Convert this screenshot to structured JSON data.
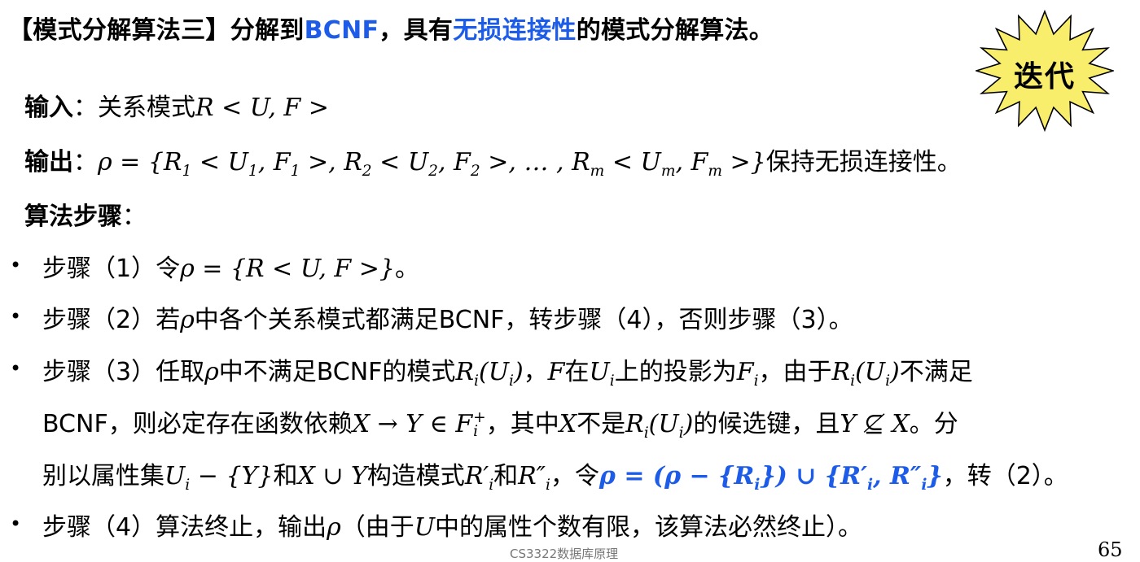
{
  "title": {
    "p1": "【模式分解算法三】分解到",
    "hl1": "BCNF",
    "p2": "，具有",
    "hl2": "无损连接性",
    "p3": "的模式分解算法。"
  },
  "badge": {
    "text": "迭代",
    "color": "#f8ee6c"
  },
  "input": {
    "label": "输入",
    "sep": "：",
    "text": "关系模式",
    "math": "R < U, F >"
  },
  "output": {
    "label": "输出",
    "sep": "：",
    "math": {
      "a": "ρ = {R",
      "a_sub": "1",
      "b": " < U",
      "b_sub": "1",
      "c": ", F",
      "c_sub": "1",
      "d": " >, R",
      "d_sub": "2",
      "e": " < U",
      "e_sub": "2",
      "f": ", F",
      "f_sub": "2",
      "g": " >, … , R",
      "g_sub": "m",
      "h": " < U",
      "h_sub": "m",
      "i": ", F",
      "i_sub": "m",
      "j": " >}"
    },
    "text": "保持无损连接性。"
  },
  "steps_heading": {
    "label": "算法步骤",
    "sep": "："
  },
  "bullet": "•",
  "step1": {
    "pre": "步骤（1）令",
    "math": "ρ = {R < U, F >}",
    "post": "。"
  },
  "step2": {
    "pre": "步骤（2）若",
    "m1": "ρ",
    "post": "中各个关系模式都满足BCNF，转步骤（4），否则步骤（3）。"
  },
  "step3": {
    "l1": {
      "t1": "步骤（3）任取",
      "m1": "ρ",
      "t2": "中不满足BCNF的模式",
      "m2": "R",
      "m2s": "i",
      "m2b": "(U",
      "m2c": "i",
      "m2d": ")",
      "t3": "，",
      "m3": "F",
      "t4": "在",
      "m4": "U",
      "m4s": "i",
      "t5": "上的投影为",
      "m5": "F",
      "m5s": "i",
      "t6": "，由于",
      "m6": "R",
      "m6s": "i",
      "m6b": "(U",
      "m6c": "i",
      "m6d": ")",
      "t7": "不满足"
    },
    "l2": {
      "t1": "BCNF，则必定存在函数依赖",
      "m1": "X → Y ∈ F",
      "m1sub": "i",
      "m1sup": "+",
      "t2": "，其中",
      "m2": "X",
      "t3": "不是",
      "m3": "R",
      "m3s": "i",
      "m3b": "(U",
      "m3c": "i",
      "m3d": ")",
      "t4": "的候选键，且",
      "m4": "Y ⊈ X",
      "t5": "。分"
    },
    "l3": {
      "t1": "别以属性集",
      "m1": "U",
      "m1s": "i",
      "m1b": " − {Y}",
      "t2": "和",
      "m2": "X ∪ Y",
      "t3": "构造模式",
      "m3": "R′",
      "m3s": "i",
      "t4": "和",
      "m4": "R″",
      "m4s": "i",
      "t5": "，令",
      "b1": "ρ = (ρ − {R",
      "b1s": "i",
      "b2": "}) ∪ {R′",
      "b2s": "i",
      "b3": ", R″",
      "b3s": "i",
      "b4": "}",
      "t6": "，转（2）。"
    }
  },
  "step4": {
    "pre": "步骤（4）算法终止，输出",
    "m1": "ρ",
    "t2": "（由于",
    "m2": "U",
    "t3": "中的属性个数有限，该算法必然终止）。"
  },
  "footer": "CS3322数据库原理",
  "page_number": "65"
}
